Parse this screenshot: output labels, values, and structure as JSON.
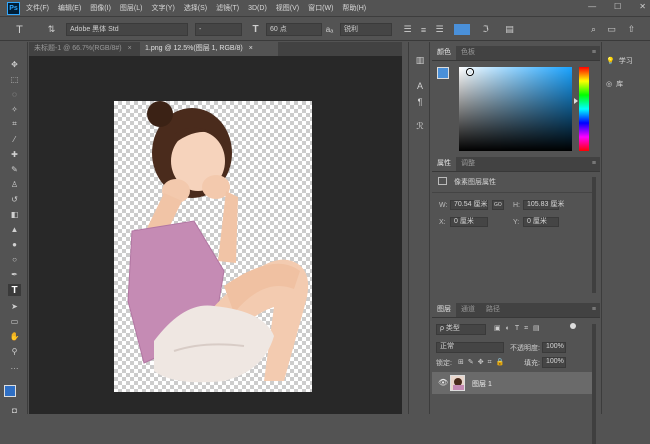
{
  "app": {
    "logo_text": "Ps",
    "menu": [
      "文件(F)",
      "编辑(E)",
      "图像(I)",
      "图层(L)",
      "文字(Y)",
      "选择(S)",
      "滤镜(T)",
      "3D(D)",
      "视图(V)",
      "窗口(W)",
      "帮助(H)"
    ],
    "window_controls": [
      "—",
      "☐",
      "✕"
    ]
  },
  "options_bar": {
    "font_family": "Adobe 黑体 Std",
    "font_style": "-",
    "font_size": "60 点",
    "antialias": "锐利"
  },
  "documents": {
    "tabs": [
      {
        "label": "未标题-1 @ 66.7%(RGB/8#)",
        "close": "×",
        "active": false
      },
      {
        "label": "1.png @ 12.5%(图层 1, RGB/8)",
        "close": "×",
        "active": true
      }
    ]
  },
  "color_panel": {
    "tabs": [
      "颜色",
      "色板"
    ],
    "accent": "#4a90d9"
  },
  "properties_panel": {
    "tabs": [
      "属性",
      "调整"
    ],
    "title": "像素图层属性",
    "w_label": "W:",
    "w_value": "70.54 厘米",
    "link_label": "GO",
    "h_label": "H:",
    "h_value": "105.83 厘米",
    "x_label": "X:",
    "x_value": "0 厘米",
    "y_label": "Y:",
    "y_value": "0 厘米"
  },
  "layers_panel": {
    "tabs": [
      "图层",
      "通道",
      "路径"
    ],
    "filter_label": "ρ 类型",
    "blend_mode": "正常",
    "opacity_label": "不透明度:",
    "opacity_value": "100%",
    "lock_label": "锁定:",
    "fill_label": "填充:",
    "fill_value": "100%",
    "layers": [
      {
        "name": "图层 1",
        "visible": true
      }
    ]
  },
  "right_panel": {
    "items": [
      {
        "label": "学习",
        "icon": "lightbulb-icon"
      },
      {
        "label": "库",
        "icon": "library-icon"
      }
    ]
  }
}
